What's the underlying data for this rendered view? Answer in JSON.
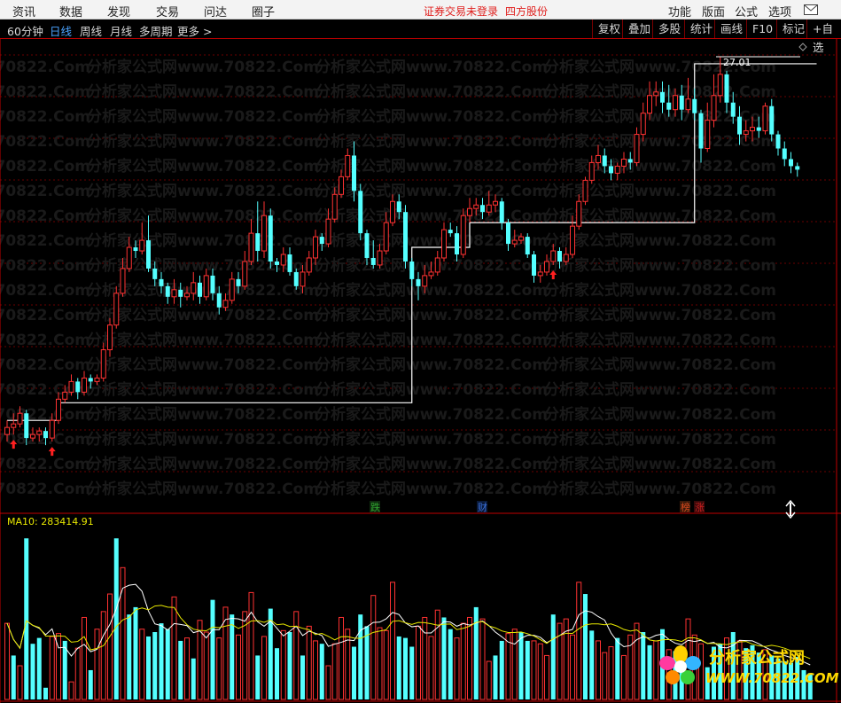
{
  "menu": {
    "left": [
      "资讯",
      "数据",
      "发现",
      "交易",
      "问达",
      "圈子"
    ],
    "center_notice": "证券交易未登录",
    "center_company": "四方股份",
    "right": [
      "功能",
      "版面",
      "公式",
      "选项"
    ],
    "mail_icon": "mail-icon"
  },
  "toolbar": {
    "tabs": [
      "60分钟",
      "日线",
      "周线",
      "月线",
      "多周期",
      "更多 >"
    ],
    "active_tab": "日线",
    "right_buttons": [
      "复权",
      "叠加",
      "多股",
      "统计",
      "画线",
      "F10",
      "标记",
      "+自选"
    ]
  },
  "price_panel": {
    "high_price_label": "27.01",
    "watermark_text": "分析家公式网www.70822.Com",
    "markers": [
      {
        "text": "跌",
        "color": "#2fa32f"
      },
      {
        "text": "财",
        "color": "#3a6fd8"
      },
      {
        "text": "榜",
        "color": "#d94a1e"
      },
      {
        "text": "涨",
        "color": "#d02020"
      }
    ]
  },
  "volume_panel": {
    "indicator_label": "MA10: 283414.91",
    "indicator_color": "#e8e800"
  },
  "logo": {
    "title": "分析家公式网",
    "url": "WWW.70822.COM"
  },
  "chart_data": {
    "type": "candlestick",
    "up_color": "#ff3232",
    "down_color": "#54ffff",
    "candles": [
      {
        "o": 16.3,
        "c": 16.5,
        "h": 16.7,
        "l": 16.1
      },
      {
        "o": 16.5,
        "c": 16.6,
        "h": 16.9,
        "l": 16.3
      },
      {
        "o": 16.6,
        "c": 16.9,
        "h": 17.1,
        "l": 16.5
      },
      {
        "o": 16.9,
        "c": 16.2,
        "h": 17.0,
        "l": 16.0
      },
      {
        "o": 16.2,
        "c": 16.3,
        "h": 16.5,
        "l": 16.1
      },
      {
        "o": 16.3,
        "c": 16.4,
        "h": 16.5,
        "l": 16.1
      },
      {
        "o": 16.4,
        "c": 16.2,
        "h": 16.5,
        "l": 16.0
      },
      {
        "o": 16.2,
        "c": 16.7,
        "h": 16.9,
        "l": 16.1
      },
      {
        "o": 16.7,
        "c": 17.3,
        "h": 17.5,
        "l": 16.6
      },
      {
        "o": 17.3,
        "c": 17.5,
        "h": 17.7,
        "l": 17.2
      },
      {
        "o": 17.5,
        "c": 17.8,
        "h": 18.0,
        "l": 17.4
      },
      {
        "o": 17.8,
        "c": 17.5,
        "h": 17.9,
        "l": 17.3
      },
      {
        "o": 17.5,
        "c": 17.9,
        "h": 18.1,
        "l": 17.4
      },
      {
        "o": 17.9,
        "c": 17.8,
        "h": 18.0,
        "l": 17.6
      },
      {
        "o": 17.8,
        "c": 17.9,
        "h": 18.0,
        "l": 17.7
      },
      {
        "o": 17.9,
        "c": 18.7,
        "h": 18.9,
        "l": 17.8
      },
      {
        "o": 18.7,
        "c": 19.4,
        "h": 19.6,
        "l": 18.5
      },
      {
        "o": 19.4,
        "c": 20.3,
        "h": 20.5,
        "l": 19.3
      },
      {
        "o": 20.3,
        "c": 21.0,
        "h": 21.3,
        "l": 20.2
      },
      {
        "o": 21.0,
        "c": 21.6,
        "h": 21.9,
        "l": 20.9
      },
      {
        "o": 21.6,
        "c": 21.5,
        "h": 21.8,
        "l": 21.3
      },
      {
        "o": 21.5,
        "c": 21.8,
        "h": 22.3,
        "l": 21.4
      },
      {
        "o": 21.8,
        "c": 21.0,
        "h": 22.5,
        "l": 20.9
      },
      {
        "o": 21.0,
        "c": 20.7,
        "h": 21.2,
        "l": 20.5
      },
      {
        "o": 20.7,
        "c": 20.5,
        "h": 20.9,
        "l": 20.3
      },
      {
        "o": 20.5,
        "c": 20.2,
        "h": 20.6,
        "l": 20.0
      },
      {
        "o": 20.2,
        "c": 20.4,
        "h": 20.7,
        "l": 20.0
      },
      {
        "o": 20.4,
        "c": 20.2,
        "h": 20.6,
        "l": 19.9
      },
      {
        "o": 20.2,
        "c": 20.3,
        "h": 20.5,
        "l": 20.1
      },
      {
        "o": 20.3,
        "c": 20.6,
        "h": 20.9,
        "l": 20.1
      },
      {
        "o": 20.6,
        "c": 20.2,
        "h": 20.8,
        "l": 20.0
      },
      {
        "o": 20.2,
        "c": 20.8,
        "h": 21.0,
        "l": 20.1
      },
      {
        "o": 20.8,
        "c": 20.3,
        "h": 21.0,
        "l": 20.1
      },
      {
        "o": 20.3,
        "c": 19.9,
        "h": 20.5,
        "l": 19.7
      },
      {
        "o": 19.9,
        "c": 20.1,
        "h": 20.3,
        "l": 19.8
      },
      {
        "o": 20.1,
        "c": 20.7,
        "h": 20.9,
        "l": 20.0
      },
      {
        "o": 20.7,
        "c": 20.5,
        "h": 20.9,
        "l": 20.3
      },
      {
        "o": 20.5,
        "c": 21.2,
        "h": 21.5,
        "l": 20.4
      },
      {
        "o": 21.2,
        "c": 22.0,
        "h": 22.4,
        "l": 21.1
      },
      {
        "o": 22.0,
        "c": 21.5,
        "h": 22.9,
        "l": 21.2
      },
      {
        "o": 21.5,
        "c": 22.5,
        "h": 22.9,
        "l": 21.3
      },
      {
        "o": 22.5,
        "c": 21.2,
        "h": 22.7,
        "l": 21.0
      },
      {
        "o": 21.2,
        "c": 21.1,
        "h": 21.3,
        "l": 20.9
      },
      {
        "o": 21.1,
        "c": 21.4,
        "h": 21.6,
        "l": 20.9
      },
      {
        "o": 21.4,
        "c": 20.9,
        "h": 21.6,
        "l": 20.8
      },
      {
        "o": 20.9,
        "c": 20.5,
        "h": 21.0,
        "l": 20.4
      },
      {
        "o": 20.5,
        "c": 20.9,
        "h": 21.1,
        "l": 20.3
      },
      {
        "o": 20.9,
        "c": 21.3,
        "h": 21.5,
        "l": 20.8
      },
      {
        "o": 21.3,
        "c": 21.9,
        "h": 22.1,
        "l": 21.1
      },
      {
        "o": 21.9,
        "c": 21.7,
        "h": 22.0,
        "l": 21.5
      },
      {
        "o": 21.7,
        "c": 22.4,
        "h": 22.7,
        "l": 21.6
      },
      {
        "o": 22.4,
        "c": 23.1,
        "h": 23.3,
        "l": 22.3
      },
      {
        "o": 23.1,
        "c": 23.6,
        "h": 23.8,
        "l": 23.0
      },
      {
        "o": 23.6,
        "c": 24.2,
        "h": 24.4,
        "l": 23.5
      },
      {
        "o": 24.2,
        "c": 23.2,
        "h": 24.6,
        "l": 22.9
      },
      {
        "o": 23.2,
        "c": 22.0,
        "h": 23.4,
        "l": 21.8
      },
      {
        "o": 22.0,
        "c": 21.3,
        "h": 22.1,
        "l": 21.1
      },
      {
        "o": 21.3,
        "c": 21.1,
        "h": 21.8,
        "l": 21.0
      },
      {
        "o": 21.1,
        "c": 21.5,
        "h": 21.7,
        "l": 21.0
      },
      {
        "o": 21.5,
        "c": 22.3,
        "h": 22.6,
        "l": 21.4
      },
      {
        "o": 22.3,
        "c": 22.9,
        "h": 23.1,
        "l": 22.2
      },
      {
        "o": 22.9,
        "c": 22.6,
        "h": 23.1,
        "l": 22.4
      },
      {
        "o": 22.6,
        "c": 21.2,
        "h": 22.8,
        "l": 21.0
      },
      {
        "o": 21.2,
        "c": 20.7,
        "h": 21.3,
        "l": 20.5
      },
      {
        "o": 20.7,
        "c": 20.5,
        "h": 20.9,
        "l": 20.1
      },
      {
        "o": 20.5,
        "c": 20.8,
        "h": 21.1,
        "l": 20.3
      },
      {
        "o": 20.8,
        "c": 20.9,
        "h": 21.2,
        "l": 20.7
      },
      {
        "o": 20.9,
        "c": 21.3,
        "h": 21.5,
        "l": 20.8
      },
      {
        "o": 21.3,
        "c": 22.1,
        "h": 22.3,
        "l": 21.2
      },
      {
        "o": 22.1,
        "c": 22.0,
        "h": 22.3,
        "l": 21.9
      },
      {
        "o": 22.0,
        "c": 21.4,
        "h": 22.2,
        "l": 21.2
      },
      {
        "o": 21.4,
        "c": 22.5,
        "h": 22.7,
        "l": 21.3
      },
      {
        "o": 22.5,
        "c": 22.7,
        "h": 23.0,
        "l": 22.3
      },
      {
        "o": 22.7,
        "c": 22.8,
        "h": 23.0,
        "l": 22.5
      },
      {
        "o": 22.8,
        "c": 22.6,
        "h": 23.0,
        "l": 22.4
      },
      {
        "o": 22.6,
        "c": 22.8,
        "h": 23.2,
        "l": 22.5
      },
      {
        "o": 22.8,
        "c": 22.9,
        "h": 23.1,
        "l": 22.6
      },
      {
        "o": 22.9,
        "c": 22.3,
        "h": 23.0,
        "l": 22.1
      },
      {
        "o": 22.3,
        "c": 21.7,
        "h": 22.4,
        "l": 21.5
      },
      {
        "o": 21.7,
        "c": 21.8,
        "h": 22.1,
        "l": 21.6
      },
      {
        "o": 21.8,
        "c": 21.9,
        "h": 22.0,
        "l": 21.7
      },
      {
        "o": 21.9,
        "c": 21.4,
        "h": 22.0,
        "l": 21.3
      },
      {
        "o": 21.4,
        "c": 20.8,
        "h": 21.5,
        "l": 20.6
      },
      {
        "o": 20.8,
        "c": 20.9,
        "h": 21.1,
        "l": 20.6
      },
      {
        "o": 20.9,
        "c": 21.2,
        "h": 21.4,
        "l": 20.8
      },
      {
        "o": 21.2,
        "c": 21.5,
        "h": 21.7,
        "l": 21.1
      },
      {
        "o": 21.5,
        "c": 21.2,
        "h": 21.6,
        "l": 21.0
      },
      {
        "o": 21.2,
        "c": 21.4,
        "h": 21.6,
        "l": 21.1
      },
      {
        "o": 21.4,
        "c": 22.2,
        "h": 22.5,
        "l": 21.3
      },
      {
        "o": 22.2,
        "c": 22.9,
        "h": 23.1,
        "l": 22.1
      },
      {
        "o": 22.9,
        "c": 23.5,
        "h": 23.6,
        "l": 22.8
      },
      {
        "o": 23.5,
        "c": 24.0,
        "h": 24.2,
        "l": 23.4
      },
      {
        "o": 24.0,
        "c": 24.2,
        "h": 24.5,
        "l": 23.8
      },
      {
        "o": 24.2,
        "c": 23.9,
        "h": 24.4,
        "l": 23.7
      },
      {
        "o": 23.9,
        "c": 23.7,
        "h": 24.1,
        "l": 23.5
      },
      {
        "o": 23.7,
        "c": 23.9,
        "h": 24.0,
        "l": 23.5
      },
      {
        "o": 23.9,
        "c": 24.1,
        "h": 24.3,
        "l": 23.7
      },
      {
        "o": 24.1,
        "c": 24.0,
        "h": 24.3,
        "l": 23.8
      },
      {
        "o": 24.0,
        "c": 24.8,
        "h": 25.0,
        "l": 23.9
      },
      {
        "o": 24.8,
        "c": 25.4,
        "h": 25.7,
        "l": 24.6
      },
      {
        "o": 25.4,
        "c": 25.9,
        "h": 26.3,
        "l": 25.2
      },
      {
        "o": 25.9,
        "c": 26.0,
        "h": 26.3,
        "l": 25.6
      },
      {
        "o": 26.0,
        "c": 25.7,
        "h": 26.3,
        "l": 25.4
      },
      {
        "o": 25.7,
        "c": 25.5,
        "h": 26.2,
        "l": 25.3
      },
      {
        "o": 25.5,
        "c": 25.9,
        "h": 26.1,
        "l": 25.3
      },
      {
        "o": 25.9,
        "c": 25.5,
        "h": 26.2,
        "l": 25.2
      },
      {
        "o": 25.5,
        "c": 25.8,
        "h": 26.4,
        "l": 25.4
      },
      {
        "o": 25.8,
        "c": 25.4,
        "h": 26.1,
        "l": 25.2
      },
      {
        "o": 25.4,
        "c": 24.4,
        "h": 25.5,
        "l": 24.0
      },
      {
        "o": 24.4,
        "c": 25.2,
        "h": 25.7,
        "l": 24.3
      },
      {
        "o": 25.2,
        "c": 25.9,
        "h": 26.5,
        "l": 25.0
      },
      {
        "o": 25.9,
        "c": 26.5,
        "h": 27.01,
        "l": 25.7
      },
      {
        "o": 26.5,
        "c": 25.7,
        "h": 26.6,
        "l": 25.4
      },
      {
        "o": 25.7,
        "c": 25.3,
        "h": 26.0,
        "l": 25.1
      },
      {
        "o": 25.3,
        "c": 24.8,
        "h": 25.6,
        "l": 24.5
      },
      {
        "o": 24.8,
        "c": 24.9,
        "h": 25.2,
        "l": 24.6
      },
      {
        "o": 24.9,
        "c": 25.0,
        "h": 25.3,
        "l": 24.6
      },
      {
        "o": 25.0,
        "c": 24.9,
        "h": 25.3,
        "l": 24.7
      },
      {
        "o": 24.9,
        "c": 25.6,
        "h": 25.7,
        "l": 24.8
      },
      {
        "o": 25.6,
        "c": 24.8,
        "h": 25.8,
        "l": 24.6
      },
      {
        "o": 24.8,
        "c": 24.4,
        "h": 24.9,
        "l": 24.2
      },
      {
        "o": 24.4,
        "c": 24.1,
        "h": 24.6,
        "l": 23.9
      },
      {
        "o": 24.1,
        "c": 23.9,
        "h": 24.3,
        "l": 23.7
      },
      {
        "o": 23.9,
        "c": 23.8,
        "h": 24.0,
        "l": 23.6
      }
    ],
    "step_line": [
      {
        "from": 0,
        "to": 8,
        "v": 16.7
      },
      {
        "from": 8,
        "to": 63,
        "v": 17.2
      },
      {
        "from": 63,
        "to": 69,
        "v": 21.6
      },
      {
        "from": 69,
        "to": 72,
        "v": 21.6
      },
      {
        "from": 72,
        "to": 107,
        "v": 22.3
      },
      {
        "from": 107,
        "to": 126,
        "v": 26.8
      }
    ],
    "volume": [
      52,
      30,
      23,
      110,
      38,
      42,
      8,
      43,
      45,
      40,
      12,
      35,
      56,
      20,
      48,
      60,
      72,
      110,
      90,
      58,
      63,
      48,
      43,
      46,
      52,
      48,
      70,
      40,
      42,
      28,
      54,
      46,
      68,
      42,
      63,
      58,
      44,
      60,
      73,
      30,
      43,
      62,
      35,
      47,
      46,
      60,
      30,
      50,
      40,
      38,
      23,
      38,
      56,
      48,
      36,
      58,
      50,
      71,
      49,
      47,
      80,
      43,
      42,
      36,
      50,
      56,
      43,
      61,
      56,
      48,
      42,
      52,
      56,
      63,
      55,
      26,
      30,
      40,
      45,
      48,
      46,
      40,
      40,
      38,
      30,
      58,
      52,
      55,
      44,
      80,
      72,
      47,
      40,
      32,
      36,
      42,
      30,
      44,
      52,
      46,
      37,
      40,
      48,
      34,
      33,
      32,
      55,
      44,
      38,
      22,
      36,
      38,
      42,
      46,
      40,
      35,
      37,
      32,
      34,
      30,
      28,
      26,
      25,
      29,
      20,
      18
    ],
    "volume_up_flags": [
      1,
      0,
      1,
      0,
      0,
      0,
      0,
      1,
      1,
      0,
      1,
      1,
      1,
      0,
      1,
      1,
      1,
      0,
      1,
      0,
      0,
      1,
      0,
      0,
      0,
      0,
      1,
      0,
      1,
      0,
      1,
      1,
      0,
      1,
      1,
      0,
      1,
      1,
      1,
      0,
      1,
      0,
      0,
      1,
      0,
      1,
      0,
      1,
      1,
      0,
      1,
      1,
      1,
      1,
      0,
      0,
      0,
      1,
      1,
      1,
      1,
      0,
      0,
      0,
      1,
      1,
      1,
      1,
      0,
      0,
      1,
      1,
      1,
      0,
      1,
      1,
      0,
      0,
      1,
      1,
      0,
      0,
      1,
      1,
      1,
      0,
      1,
      1,
      1,
      1,
      0,
      0,
      1,
      1,
      1,
      0,
      1,
      1,
      1,
      0,
      0,
      1,
      0,
      1,
      0,
      0,
      1,
      1,
      1,
      0,
      0,
      0,
      1,
      0,
      1,
      0,
      0,
      0,
      1,
      0,
      0,
      0,
      0,
      0,
      0,
      0
    ]
  }
}
